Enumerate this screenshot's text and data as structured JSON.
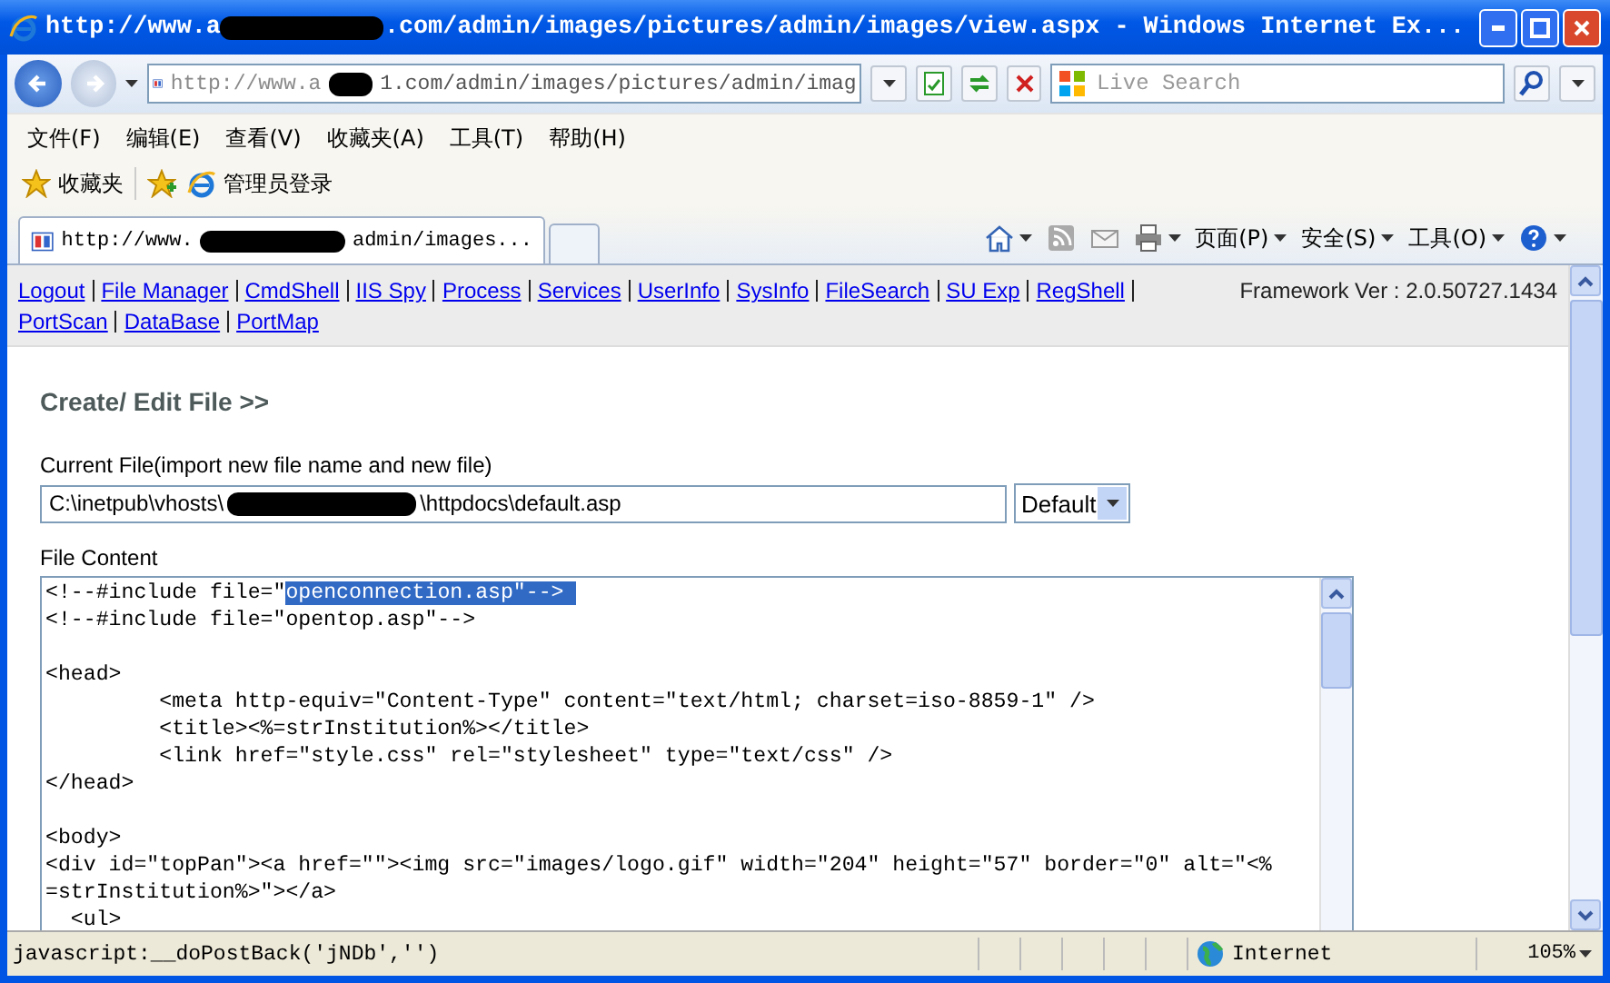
{
  "window": {
    "title_start": "http://www.a",
    "title_end": ".com/admin/images/pictures/admin/images/view.aspx - Windows Internet Ex..."
  },
  "address_bar": {
    "start": "http://www.a",
    "end": "1.com/admin/images/pictures/admin/imag"
  },
  "search": {
    "placeholder": "Live Search"
  },
  "menu": [
    "文件(F)",
    "编辑(E)",
    "查看(V)",
    "收藏夹(A)",
    "工具(T)",
    "帮助(H)"
  ],
  "favorites": {
    "label": "收藏夹",
    "links": [
      "管理员登录"
    ]
  },
  "tab": {
    "start": "http://www.",
    "end": "admin/images..."
  },
  "command_menus": [
    "页面(P)",
    "安全(S)",
    "工具(O)"
  ],
  "nav_links": [
    "Logout",
    "File Manager",
    "CmdShell",
    "IIS Spy",
    "Process",
    "Services",
    "UserInfo",
    "SysInfo",
    "FileSearch",
    "SU Exp",
    "RegShell",
    "PortScan",
    "DataBase",
    "PortMap"
  ],
  "framework": "Framework Ver : 2.0.50727.1434",
  "heading": "Create/ Edit File >>",
  "current_file": {
    "label": "Current File(import new file name and new file)",
    "start": "C:\\inetpub\\vhosts\\",
    "end": "\\httpdocs\\default.asp"
  },
  "encoding": {
    "value": "Default"
  },
  "content": {
    "label": "File Content",
    "lines": [
      {
        "kind": "code",
        "text": "<!--#include file=\"",
        "highlight": "openconnection.asp\"--> "
      },
      {
        "kind": "code",
        "text": "<!--#include file=\"opentop.asp\"-->"
      },
      {
        "kind": "blank"
      },
      {
        "kind": "code",
        "text": "<head>"
      },
      {
        "kind": "code",
        "text": "         <meta http-equiv=\"Content-Type\" content=\"text/html; charset=iso-8859-1\" />"
      },
      {
        "kind": "code",
        "text": "         <title><%=strInstitution%></title>"
      },
      {
        "kind": "code",
        "text": "         <link href=\"style.css\" rel=\"stylesheet\" type=\"text/css\" />"
      },
      {
        "kind": "code",
        "text": "</head>"
      },
      {
        "kind": "blank"
      },
      {
        "kind": "code",
        "text": "<body>"
      },
      {
        "kind": "code",
        "text": "<div id=\"topPan\"><a href=\"\"><img src=\"images/logo.gif\" width=\"204\" height=\"57\" border=\"0\" alt=\"<%"
      },
      {
        "kind": "code",
        "text": "=strInstitution%>\"></a>"
      },
      {
        "kind": "code",
        "text": "  <ul>"
      }
    ]
  },
  "status_bar": {
    "text": "javascript:__doPostBack('jNDb','')",
    "zone": "Internet",
    "zoom": "105%"
  }
}
